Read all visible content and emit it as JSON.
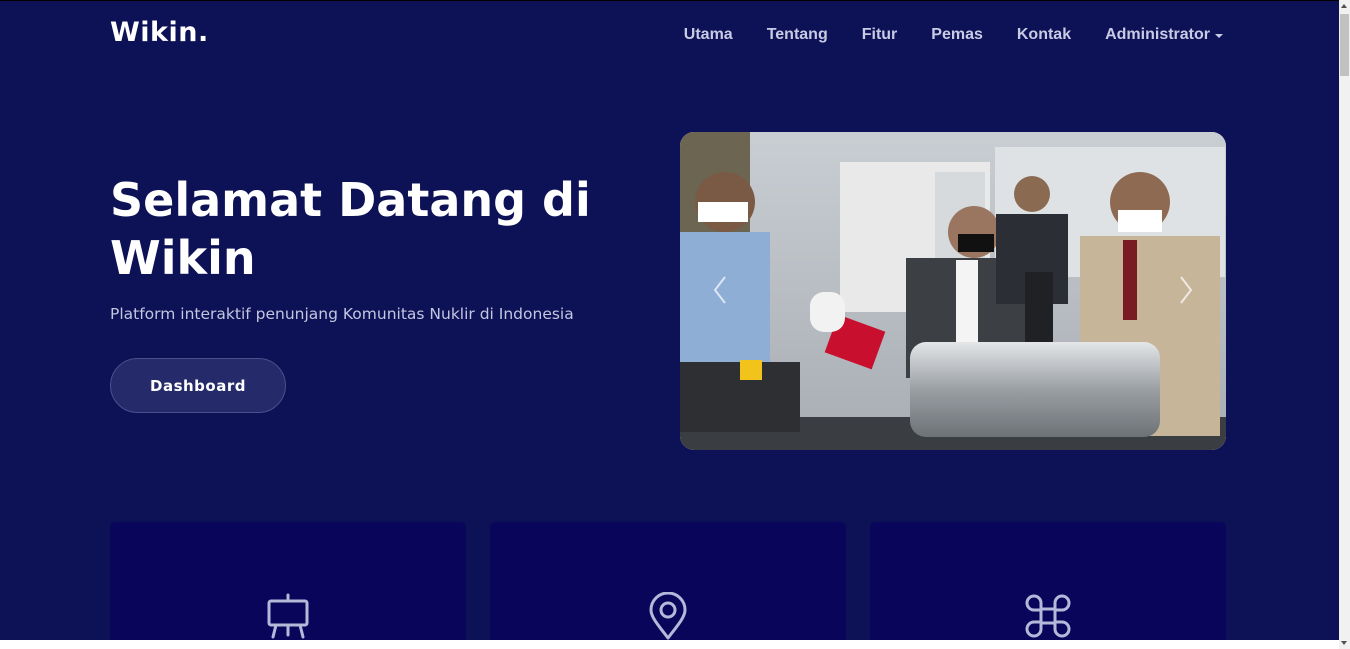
{
  "header": {
    "logo": "Wikin.",
    "nav": [
      "Utama",
      "Tentang",
      "Fitur",
      "Pemas",
      "Kontak"
    ],
    "admin_menu": "Administrator"
  },
  "hero": {
    "title": "Selamat Datang di Wikin",
    "subtitle": "Platform interaktif penunjang Komunitas Nuklir di Indonesia",
    "button": "Dashboard"
  },
  "carousel": {
    "prev_icon": "chevron-left-icon",
    "next_icon": "chevron-right-icon"
  },
  "cards": [
    {
      "icon": "presentation-board-icon"
    },
    {
      "icon": "map-pin-icon"
    },
    {
      "icon": "command-key-icon"
    }
  ],
  "colors": {
    "background": "#0d1155",
    "card": "#09055a",
    "button": "#242a6a",
    "nav_text": "#c8cbe4"
  }
}
